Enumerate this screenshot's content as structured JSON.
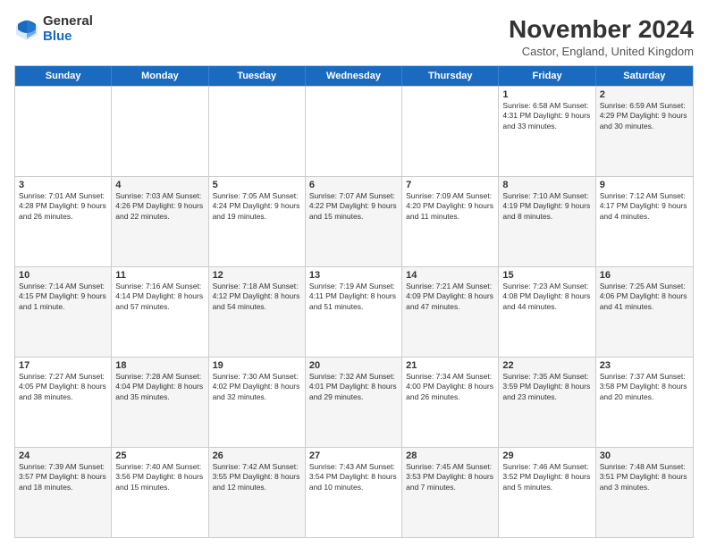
{
  "logo": {
    "general": "General",
    "blue": "Blue"
  },
  "title": "November 2024",
  "subtitle": "Castor, England, United Kingdom",
  "days": [
    "Sunday",
    "Monday",
    "Tuesday",
    "Wednesday",
    "Thursday",
    "Friday",
    "Saturday"
  ],
  "rows": [
    [
      {
        "day": "",
        "info": "",
        "empty": true
      },
      {
        "day": "",
        "info": "",
        "empty": true
      },
      {
        "day": "",
        "info": "",
        "empty": true
      },
      {
        "day": "",
        "info": "",
        "empty": true
      },
      {
        "day": "",
        "info": "",
        "empty": true
      },
      {
        "day": "1",
        "info": "Sunrise: 6:58 AM\nSunset: 4:31 PM\nDaylight: 9 hours and 33 minutes."
      },
      {
        "day": "2",
        "info": "Sunrise: 6:59 AM\nSunset: 4:29 PM\nDaylight: 9 hours and 30 minutes.",
        "alt": true
      }
    ],
    [
      {
        "day": "3",
        "info": "Sunrise: 7:01 AM\nSunset: 4:28 PM\nDaylight: 9 hours and 26 minutes."
      },
      {
        "day": "4",
        "info": "Sunrise: 7:03 AM\nSunset: 4:26 PM\nDaylight: 9 hours and 22 minutes.",
        "alt": true
      },
      {
        "day": "5",
        "info": "Sunrise: 7:05 AM\nSunset: 4:24 PM\nDaylight: 9 hours and 19 minutes."
      },
      {
        "day": "6",
        "info": "Sunrise: 7:07 AM\nSunset: 4:22 PM\nDaylight: 9 hours and 15 minutes.",
        "alt": true
      },
      {
        "day": "7",
        "info": "Sunrise: 7:09 AM\nSunset: 4:20 PM\nDaylight: 9 hours and 11 minutes."
      },
      {
        "day": "8",
        "info": "Sunrise: 7:10 AM\nSunset: 4:19 PM\nDaylight: 9 hours and 8 minutes.",
        "alt": true
      },
      {
        "day": "9",
        "info": "Sunrise: 7:12 AM\nSunset: 4:17 PM\nDaylight: 9 hours and 4 minutes."
      }
    ],
    [
      {
        "day": "10",
        "info": "Sunrise: 7:14 AM\nSunset: 4:15 PM\nDaylight: 9 hours and 1 minute.",
        "alt": true
      },
      {
        "day": "11",
        "info": "Sunrise: 7:16 AM\nSunset: 4:14 PM\nDaylight: 8 hours and 57 minutes."
      },
      {
        "day": "12",
        "info": "Sunrise: 7:18 AM\nSunset: 4:12 PM\nDaylight: 8 hours and 54 minutes.",
        "alt": true
      },
      {
        "day": "13",
        "info": "Sunrise: 7:19 AM\nSunset: 4:11 PM\nDaylight: 8 hours and 51 minutes."
      },
      {
        "day": "14",
        "info": "Sunrise: 7:21 AM\nSunset: 4:09 PM\nDaylight: 8 hours and 47 minutes.",
        "alt": true
      },
      {
        "day": "15",
        "info": "Sunrise: 7:23 AM\nSunset: 4:08 PM\nDaylight: 8 hours and 44 minutes."
      },
      {
        "day": "16",
        "info": "Sunrise: 7:25 AM\nSunset: 4:06 PM\nDaylight: 8 hours and 41 minutes.",
        "alt": true
      }
    ],
    [
      {
        "day": "17",
        "info": "Sunrise: 7:27 AM\nSunset: 4:05 PM\nDaylight: 8 hours and 38 minutes."
      },
      {
        "day": "18",
        "info": "Sunrise: 7:28 AM\nSunset: 4:04 PM\nDaylight: 8 hours and 35 minutes.",
        "alt": true
      },
      {
        "day": "19",
        "info": "Sunrise: 7:30 AM\nSunset: 4:02 PM\nDaylight: 8 hours and 32 minutes."
      },
      {
        "day": "20",
        "info": "Sunrise: 7:32 AM\nSunset: 4:01 PM\nDaylight: 8 hours and 29 minutes.",
        "alt": true
      },
      {
        "day": "21",
        "info": "Sunrise: 7:34 AM\nSunset: 4:00 PM\nDaylight: 8 hours and 26 minutes."
      },
      {
        "day": "22",
        "info": "Sunrise: 7:35 AM\nSunset: 3:59 PM\nDaylight: 8 hours and 23 minutes.",
        "alt": true
      },
      {
        "day": "23",
        "info": "Sunrise: 7:37 AM\nSunset: 3:58 PM\nDaylight: 8 hours and 20 minutes."
      }
    ],
    [
      {
        "day": "24",
        "info": "Sunrise: 7:39 AM\nSunset: 3:57 PM\nDaylight: 8 hours and 18 minutes.",
        "alt": true
      },
      {
        "day": "25",
        "info": "Sunrise: 7:40 AM\nSunset: 3:56 PM\nDaylight: 8 hours and 15 minutes."
      },
      {
        "day": "26",
        "info": "Sunrise: 7:42 AM\nSunset: 3:55 PM\nDaylight: 8 hours and 12 minutes.",
        "alt": true
      },
      {
        "day": "27",
        "info": "Sunrise: 7:43 AM\nSunset: 3:54 PM\nDaylight: 8 hours and 10 minutes."
      },
      {
        "day": "28",
        "info": "Sunrise: 7:45 AM\nSunset: 3:53 PM\nDaylight: 8 hours and 7 minutes.",
        "alt": true
      },
      {
        "day": "29",
        "info": "Sunrise: 7:46 AM\nSunset: 3:52 PM\nDaylight: 8 hours and 5 minutes."
      },
      {
        "day": "30",
        "info": "Sunrise: 7:48 AM\nSunset: 3:51 PM\nDaylight: 8 hours and 3 minutes.",
        "alt": true
      }
    ]
  ]
}
